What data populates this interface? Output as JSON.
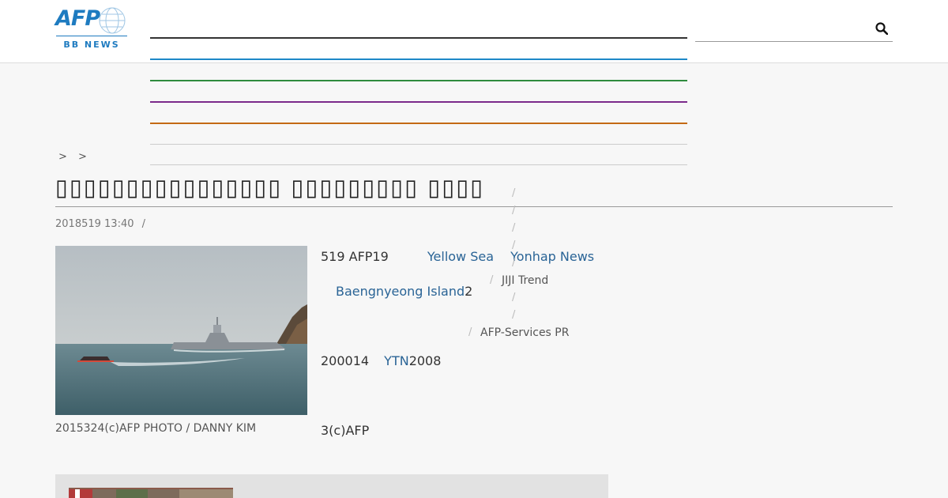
{
  "header": {
    "logo_main": "AFP",
    "logo_sub": "BB NEWS",
    "nav_colors": [
      "#333333",
      "#1e88c7",
      "#2e8b3e",
      "#7b2a8b",
      "#c46a14",
      "#cccccc",
      "#cccccc"
    ],
    "brand_color": "#1e7bc0"
  },
  "search": {
    "icon": "search-icon"
  },
  "breadcrumb": {
    "sep1": ">",
    "sep2": ">"
  },
  "article": {
    "title": "▯▯▯▯▯▯▯▯▯▯▯▯▯▯▯▯ ▯▯▯▯▯▯▯▯▯ ▯▯▯▯",
    "date": "2018519 13:40",
    "date_sep": "/",
    "photo_caption": "2015324(c)AFP PHOTO / DANNY KIM",
    "p1_start": "519 AFP19",
    "p1_link1": "Yellow Sea",
    "p1_link2": "Yonhap News",
    "p2_link": "Baengnyeong Island",
    "p2_end": "2",
    "p3_start": "200014",
    "p3_link": "YTN",
    "p3_end": "2008",
    "p4": "3(c)AFP"
  },
  "sidebar": {
    "separator": "/",
    "item_jiji": "JIJI Trend",
    "item_afp": "AFP-Services PR"
  }
}
